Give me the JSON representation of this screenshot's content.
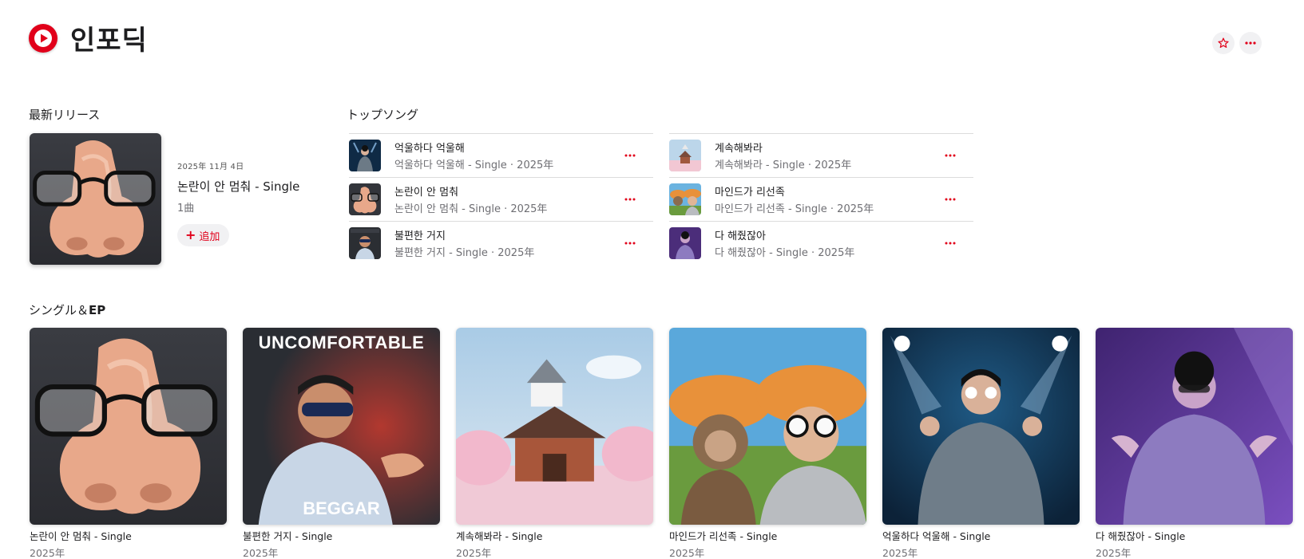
{
  "artist": {
    "name": "인포딕"
  },
  "colors": {
    "accent": "#e1001a",
    "text": "#1d1d1f",
    "secondary": "#6e6e73"
  },
  "header": {
    "favorite_icon": "star-icon",
    "more_icon": "ellipsis-icon"
  },
  "latest_release": {
    "section_title": "最新リリース",
    "date": "2025年 11月 4日",
    "title": "논란이 안 멈춰 - Single",
    "track_count": "1曲",
    "add_label": "追加"
  },
  "top_songs": {
    "section_title": "トップソング",
    "columns": [
      [
        {
          "title": "억울하다 억울해",
          "subtitle": "억울하다 억울해 - Single · 2025年"
        },
        {
          "title": "논란이 안 멈춰",
          "subtitle": "논란이 안 멈춰 - Single · 2025年"
        },
        {
          "title": "불편한 거지",
          "subtitle": "불편한 거지 - Single · 2025年"
        }
      ],
      [
        {
          "title": "계속해봐라",
          "subtitle": "계속해봐라 - Single · 2025年"
        },
        {
          "title": "마인드가 리선족",
          "subtitle": "마인드가 리선족 - Single · 2025年"
        },
        {
          "title": "다 해줬잖아",
          "subtitle": "다 해줬잖아 - Single · 2025年"
        }
      ]
    ]
  },
  "singles": {
    "section_title_prefix": "シングル＆",
    "section_title_bold": "EP",
    "items": [
      {
        "title": "논란이 안 멈춰 - Single",
        "year": "2025年"
      },
      {
        "title": "불편한 거지 - Single",
        "year": "2025年",
        "cover_top_text": "UNCOMFORTABLE",
        "cover_bottom_text": "BEGGAR"
      },
      {
        "title": "계속해봐라 - Single",
        "year": "2025年"
      },
      {
        "title": "마인드가 리선족 - Single",
        "year": "2025年"
      },
      {
        "title": "억울하다 억울해 - Single",
        "year": "2025年"
      },
      {
        "title": "다 해줬잖아 - Single",
        "year": "2025年"
      }
    ]
  }
}
